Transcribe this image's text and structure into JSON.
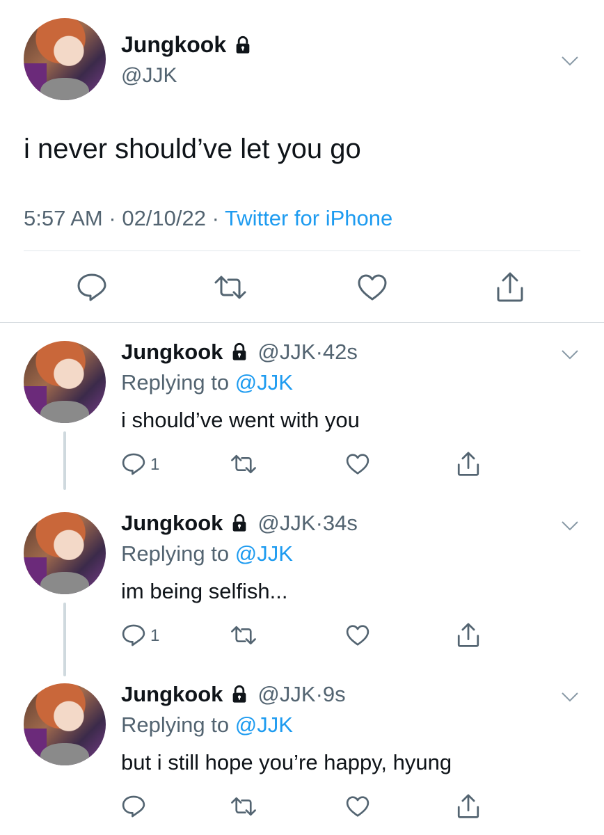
{
  "main_tweet": {
    "name": "Jungkook",
    "handle": "@JJK",
    "text": "i never should’ve let you go",
    "time": "5:57 AM",
    "date": "02/10/22",
    "separator": "·",
    "source": "Twitter for iPhone"
  },
  "replies": [
    {
      "name": "Jungkook",
      "handle": "@JJK",
      "dot": "·",
      "time": "42s",
      "replying_prefix": "Replying to ",
      "replying_to": "@JJK",
      "text": "i should’ve went with you",
      "reply_count": "1"
    },
    {
      "name": "Jungkook",
      "handle": "@JJK",
      "dot": "·",
      "time": "34s",
      "replying_prefix": "Replying to ",
      "replying_to": "@JJK",
      "text": "im being selfish...",
      "reply_count": "1"
    },
    {
      "name": "Jungkook",
      "handle": "@JJK",
      "dot": "·",
      "time": "9s",
      "replying_prefix": "Replying to ",
      "replying_to": "@JJK",
      "text": "but i still hope you’re happy, hyung",
      "reply_count": ""
    }
  ],
  "colors": {
    "link": "#1d9bf0",
    "secondary_text": "#536471",
    "icon": "#536471",
    "divider": "#e1e6ea"
  },
  "icons": {
    "lock": "lock-icon",
    "chevron": "chevron-down-icon",
    "reply": "reply-icon",
    "retweet": "retweet-icon",
    "like": "heart-icon",
    "share": "share-icon"
  }
}
